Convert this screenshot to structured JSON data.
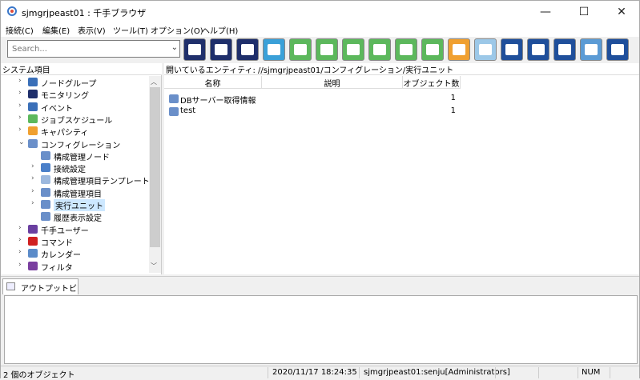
{
  "window": {
    "title": "sjmgrjpeast01 : 千手ブラウザ",
    "minimize": "—",
    "maximize": "☐",
    "close": "✕"
  },
  "menu": [
    "接続(C)",
    "編集(E)",
    "表示(V)",
    "ツール(T)",
    "オプション(O)",
    "ヘルプ(H)"
  ],
  "search": {
    "placeholder": "Search..."
  },
  "toolbar_buttons": [
    {
      "name": "node-group-icon",
      "color": "#1f2f6b"
    },
    {
      "name": "monitor-icon",
      "color": "#1f2f6b"
    },
    {
      "name": "event-icon",
      "color": "#1f2f6b"
    },
    {
      "name": "schedule-icon",
      "color": "#3aa0d8"
    },
    {
      "name": "puzzle-icon",
      "color": "#5cb85c"
    },
    {
      "name": "check-puzzle-icon",
      "color": "#5cb85c"
    },
    {
      "name": "puzzle-green-icon",
      "color": "#5cb85c"
    },
    {
      "name": "check-screen-icon",
      "color": "#5cb85c"
    },
    {
      "name": "bar-chart-icon",
      "color": "#5cb85c"
    },
    {
      "name": "list-icon",
      "color": "#5cb85c"
    },
    {
      "name": "chart-orange-icon",
      "color": "#f0a030"
    },
    {
      "name": "puzzle-blue-icon",
      "color": "#9cc8e8"
    },
    {
      "name": "export-icon",
      "color": "#1f4f9b"
    },
    {
      "name": "upload-icon",
      "color": "#1f4f9b"
    },
    {
      "name": "download-icon",
      "color": "#1f4f9b"
    },
    {
      "name": "log-icon",
      "color": "#5b9bd5"
    },
    {
      "name": "radar-icon",
      "color": "#1f4f9b"
    }
  ],
  "tree": {
    "header": "システム項目",
    "nodes": [
      {
        "label": "ノードグループ",
        "arrow": "›",
        "indent": 0,
        "icon": "node-group-icon",
        "color": "#3a6fb8"
      },
      {
        "label": "モニタリング",
        "arrow": "›",
        "indent": 0,
        "icon": "monitoring-icon",
        "color": "#1f2f6b"
      },
      {
        "label": "イベント",
        "arrow": "›",
        "indent": 0,
        "icon": "event-icon",
        "color": "#3a6fb8"
      },
      {
        "label": "ジョブスケジュール",
        "arrow": "›",
        "indent": 0,
        "icon": "job-schedule-icon",
        "color": "#5cb85c"
      },
      {
        "label": "キャパシティ",
        "arrow": "›",
        "indent": 0,
        "icon": "capacity-icon",
        "color": "#f0a030"
      },
      {
        "label": "コンフィグレーション",
        "arrow": "⌄",
        "indent": 0,
        "icon": "configuration-icon",
        "color": "#6a8fc9"
      },
      {
        "label": "構成管理ノード",
        "arrow": "",
        "indent": 1,
        "icon": "config-node-icon",
        "color": "#6a8fc9"
      },
      {
        "label": "接続設定",
        "arrow": "›",
        "indent": 1,
        "icon": "link-icon",
        "color": "#4a7fc9"
      },
      {
        "label": "構成管理項目テンプレート",
        "arrow": "›",
        "indent": 1,
        "icon": "template-icon",
        "color": "#9cb8de"
      },
      {
        "label": "構成管理項目",
        "arrow": "›",
        "indent": 1,
        "icon": "config-item-icon",
        "color": "#6a8fc9"
      },
      {
        "label": "実行ユニット",
        "arrow": "›",
        "indent": 1,
        "icon": "exec-unit-icon",
        "color": "#6a8fc9",
        "selected": true
      },
      {
        "label": "履歴表示設定",
        "arrow": "",
        "indent": 1,
        "icon": "history-icon",
        "color": "#6a8fc9"
      },
      {
        "label": "千手ユーザー",
        "arrow": "›",
        "indent": 0,
        "icon": "user-icon",
        "color": "#6a3fa0"
      },
      {
        "label": "コマンド",
        "arrow": "›",
        "indent": 0,
        "icon": "command-icon",
        "color": "#d02020"
      },
      {
        "label": "カレンダー",
        "arrow": "›",
        "indent": 0,
        "icon": "calendar-icon",
        "color": "#5b8bc9"
      },
      {
        "label": "フィルタ",
        "arrow": "›",
        "indent": 0,
        "icon": "filter-icon",
        "color": "#7a3fa0"
      }
    ]
  },
  "main": {
    "path": "開いているエンティティ: //sjmgrjpeast01/コンフィグレーション/実行ユニット",
    "columns": [
      "名称",
      "説明",
      "オブジェクト数"
    ],
    "rows": [
      {
        "name": "DBサーバー取得情報",
        "description": "",
        "count": "1"
      },
      {
        "name": "test",
        "description": "",
        "count": "1"
      }
    ]
  },
  "output": {
    "tab": "アウトプットビュー"
  },
  "status": {
    "objects": "2 個のオブジェクト",
    "datetime": "2020/11/17 18:24:35",
    "user": "sjmgrjpeast01:senju[Administrators]",
    "num": "NUM"
  }
}
